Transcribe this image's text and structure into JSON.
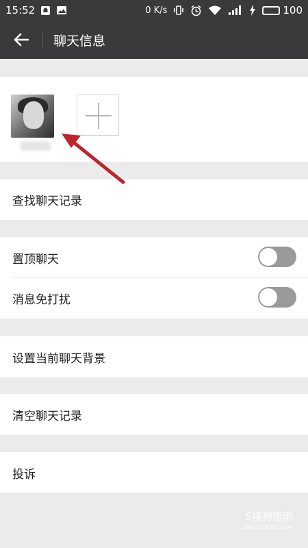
{
  "status_bar": {
    "time": "15:52",
    "net_speed": "0 K/s",
    "battery": "100",
    "icons": [
      "notification-bell-icon",
      "image-icon",
      "vibrate-icon",
      "alarm-icon",
      "wifi-icon",
      "signal-icon",
      "charging-icon",
      "battery-icon"
    ]
  },
  "app_bar": {
    "title": "聊天信息",
    "back_icon": "back-arrow-icon"
  },
  "members": {
    "add_icon": "plus-icon"
  },
  "rows": {
    "find_history": "查找聊天记录",
    "pin_chat": "置顶聊天",
    "mute": "消息免打扰",
    "set_background": "设置当前聊天背景",
    "clear_history": "清空聊天记录",
    "report": "投诉"
  },
  "toggles": {
    "pin_chat_on": false,
    "mute_on": false
  },
  "colors": {
    "bar": "#3a3a3c",
    "arrow": "#c0232b",
    "toggle_off": "#9a9a9a",
    "page_bg": "#ebebeb"
  },
  "watermark": {
    "main": "S搜狗指南",
    "sub": "zhinan.sogou.com"
  }
}
